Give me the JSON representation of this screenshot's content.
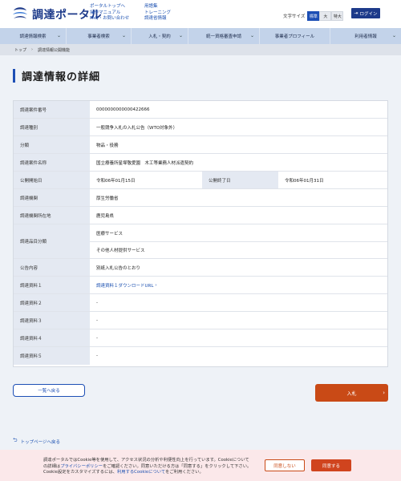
{
  "header": {
    "logo_text": "調達ポータル",
    "links_col1": [
      "ポータルトップへ",
      "操作マニュアル",
      "FAQ・お問い合わせ"
    ],
    "links_col2": [
      "用語集",
      "トレーニング",
      "調達省情報"
    ],
    "font_size_label": "文字サイズ",
    "font_sizes": [
      "標準",
      "大",
      "特大"
    ],
    "login_label": "ログイン"
  },
  "nav": {
    "items": [
      "調達情報検索",
      "事業者検索",
      "入札・契約",
      "統一資格審査申請",
      "事業者プロフィール",
      "利用者情報"
    ]
  },
  "breadcrumb": {
    "home": "トップ",
    "current": "調達情報公開機能"
  },
  "page_title": "調達情報の詳細",
  "table": {
    "case_number_label": "調達案件番号",
    "case_number": "0000000000000422666",
    "type_label": "調達種別",
    "type": "一般競争入札の入札公告（WTO対象外）",
    "category_label": "分類",
    "category": "物品・役務",
    "name_label": "調達案件名称",
    "name": "国立療養所星塚敬愛園　木工等業務人材派遣契約",
    "start_label": "公開開始日",
    "start": "令和06年01月15日",
    "end_label": "公開終了日",
    "end": "令和06年01月31日",
    "org_label": "調達機関",
    "org": "厚生労働省",
    "location_label": "調達機関所在地",
    "location": "鹿児島県",
    "item_category_label": "調達品目分類",
    "item_categories": [
      "医療サービス",
      "その他人材提供サービス"
    ],
    "notice_label": "公告内容",
    "notice": "別紙入札公告のとおり",
    "docs": [
      {
        "label": "調達資料１",
        "value": "調達資料１ダウンロードURL"
      },
      {
        "label": "調達資料２",
        "value": "-"
      },
      {
        "label": "調達資料３",
        "value": "-"
      },
      {
        "label": "調達資料４",
        "value": "-"
      },
      {
        "label": "調達資料５",
        "value": "-"
      }
    ]
  },
  "buttons": {
    "back": "一覧へ戻る",
    "bid": "入札"
  },
  "top_link": "トップページへ戻る",
  "cookie": {
    "text_1": "調達ポータルではCookie等を使用して、アクセス状況の分析や利便性向上を行っています。Cookieについての詳細は",
    "policy_link": "プライバシーポリシー",
    "text_2": "をご確認ください。同意いただける方は「同意する」をクリックして下さい。Cookie設定をカスタマイズするには、",
    "settings_link": "利用するCookieについて",
    "text_3": "をご利用ください。",
    "deny": "同意しない",
    "accept": "同意する"
  },
  "colors": {
    "brand": "#1d3a8a",
    "accent": "#1d4fb5",
    "bid_button": "#c94a16",
    "nav_bg": "#c3d3ea"
  }
}
